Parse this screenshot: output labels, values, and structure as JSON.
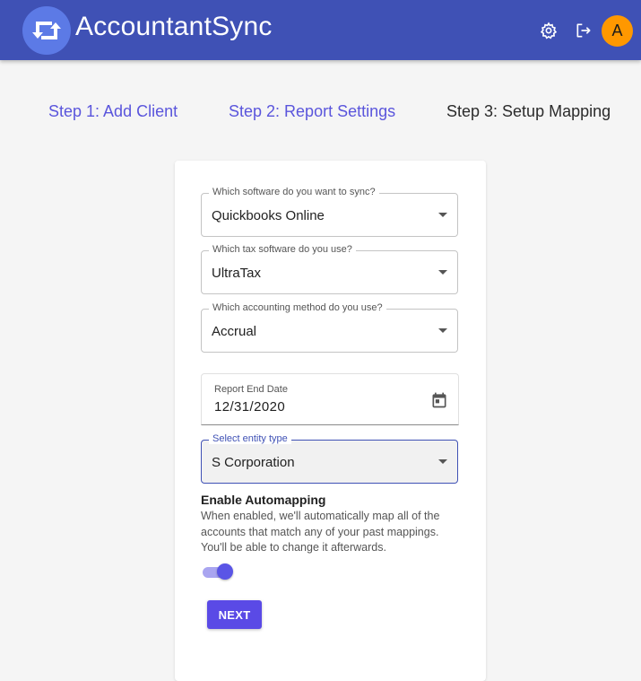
{
  "header": {
    "brand": "AccountantSync",
    "avatar_initial": "A",
    "icons": {
      "logo": "sync-arrows-icon",
      "settings": "gear-icon",
      "logout": "logout-icon"
    },
    "colors": {
      "bar": "#3f51b5",
      "avatar": "#ff9800"
    }
  },
  "steps": [
    {
      "label": "Step 1: Add Client"
    },
    {
      "label": "Step 2: Report Settings"
    },
    {
      "label": "Step 3: Setup Mapping"
    }
  ],
  "form": {
    "software": {
      "label": "Which software do you want to sync?",
      "value": "Quickbooks Online"
    },
    "tax_software": {
      "label": "Which tax software do you use?",
      "value": "UltraTax"
    },
    "accounting_method": {
      "label": "Which accounting method do you use?",
      "value": "Accrual"
    },
    "report_end_date": {
      "label": "Report End Date",
      "value": "12/31/2020"
    },
    "entity_type": {
      "label": "Select entity type",
      "value": "S Corporation"
    },
    "automapping": {
      "title": "Enable Automapping",
      "description": "When enabled, we'll automatically map all of the accounts that match any of your past mappings. You'll be able to change it afterwards.",
      "enabled": true
    },
    "next_label": "NEXT"
  },
  "colors": {
    "accent": "#5a4ae6",
    "link": "#5a55dc"
  }
}
